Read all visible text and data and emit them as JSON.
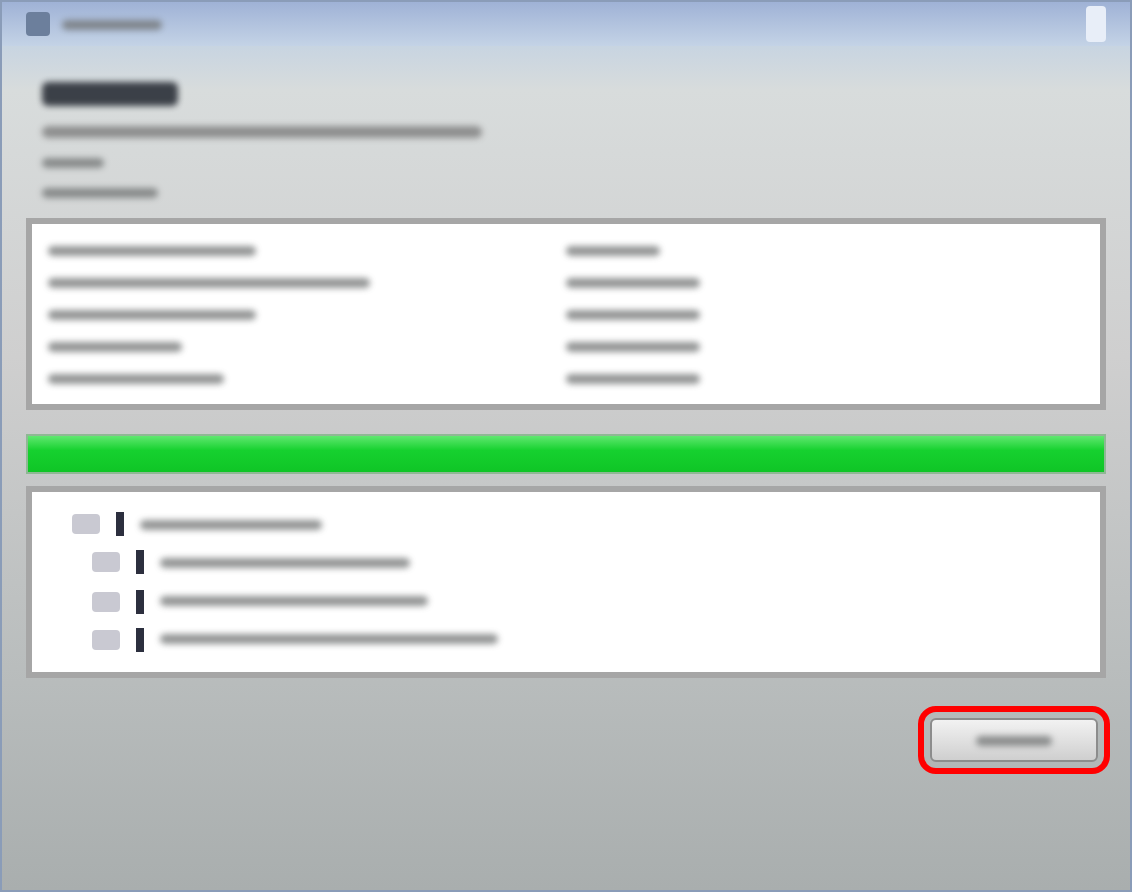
{
  "header": {
    "lines": [
      {
        "kind": "title"
      },
      {
        "kind": "subtitle"
      },
      {
        "kind": "label"
      },
      {
        "kind": "label"
      }
    ]
  },
  "details": {
    "rows": [
      {
        "kind": "pair"
      },
      {
        "kind": "pair"
      },
      {
        "kind": "pair"
      },
      {
        "kind": "pair"
      },
      {
        "kind": "pair"
      }
    ]
  },
  "progress": {
    "level": 1
  },
  "log": {
    "entries": [
      {
        "kind": "entry"
      },
      {
        "kind": "entry"
      },
      {
        "kind": "entry"
      },
      {
        "kind": "entry"
      }
    ]
  },
  "close_button": {
    "highlighted": true
  }
}
